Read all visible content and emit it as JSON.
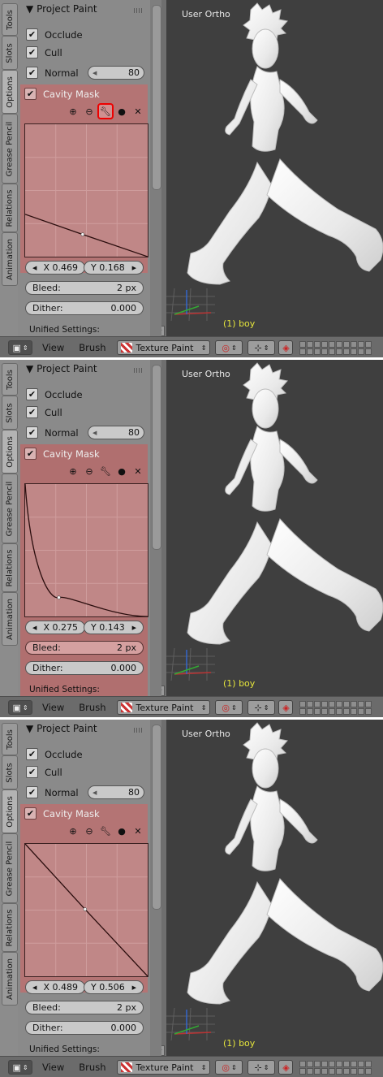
{
  "tabs": [
    "Tools",
    "Slots",
    "Options",
    "Grease Pencil",
    "Relations",
    "Animation"
  ],
  "panel": {
    "header": "Project Paint",
    "occlude": "Occlude",
    "cull": "Cull",
    "normal": "Normal",
    "normal_value": "80",
    "cavity": "Cavity Mask",
    "bleed_label": "Bleed:",
    "bleed_value": "2 px",
    "dither_label": "Dither:",
    "dither_value": "0.000",
    "unified": "Unified Settings:"
  },
  "viewport": {
    "label": "User Ortho",
    "object": "(1) boy"
  },
  "footer": {
    "view": "View",
    "brush": "Brush",
    "mode": "Texture Paint"
  },
  "frames": [
    {
      "x": "X 0.469",
      "y": "Y 0.168",
      "curve": {
        "start": [
          0.0,
          0.32
        ],
        "end": [
          1.0,
          0.0
        ],
        "point": [
          0.469,
          0.168
        ],
        "kind": "linear-ish"
      },
      "wrench_highlight": true,
      "bleed_highlight": false
    },
    {
      "x": "X 0.275",
      "y": "Y 0.143",
      "curve": {
        "start": [
          0.0,
          1.0
        ],
        "end": [
          1.0,
          0.0
        ],
        "point": [
          0.275,
          0.143
        ],
        "kind": "exponential"
      },
      "wrench_highlight": false,
      "bleed_highlight": true
    },
    {
      "x": "X 0.489",
      "y": "Y 0.506",
      "curve": {
        "start": [
          0.0,
          1.0
        ],
        "end": [
          1.0,
          0.0
        ],
        "point": [
          0.489,
          0.506
        ],
        "kind": "linear"
      },
      "wrench_highlight": false,
      "bleed_highlight": false
    }
  ],
  "colors": {
    "cavity": "#b47474",
    "viewport": "#3f3f3f",
    "object_label": "#e6e63c"
  }
}
